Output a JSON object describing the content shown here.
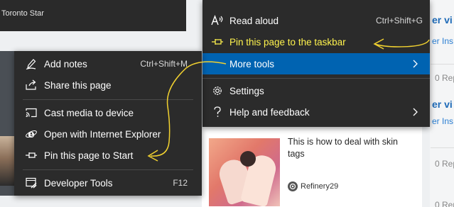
{
  "background": {
    "top_card_source": "Toronto Star",
    "right_column": {
      "link1": "er vi",
      "sub1": "er Ins",
      "replies1": "0 Repl",
      "link2": "er vi",
      "sub2": "er Ins",
      "replies2": "0 Repl",
      "replies3": "0 Repl"
    },
    "article": {
      "title": "This is how to deal with skin tags",
      "source": "Refinery29"
    }
  },
  "main_menu": {
    "items": [
      {
        "label": "Read aloud",
        "shortcut": "Ctrl+Shift+G",
        "icon": "read-aloud-icon"
      },
      {
        "label": "Pin this page to the taskbar",
        "icon": "pin-icon"
      },
      {
        "label": "More tools",
        "icon": "none"
      },
      {
        "label": "Settings",
        "icon": "gear-icon"
      },
      {
        "label": "Help and feedback",
        "icon": "question-mark-icon"
      }
    ]
  },
  "sub_menu": {
    "items": [
      {
        "label": "Add notes",
        "shortcut": "Ctrl+Shift+M",
        "icon": "pen-icon"
      },
      {
        "label": "Share this page",
        "icon": "share-icon"
      },
      {
        "label": "Cast media to device",
        "icon": "cast-icon"
      },
      {
        "label": "Open with Internet Explorer",
        "icon": "internet-explorer-icon"
      },
      {
        "label": "Pin this page to Start",
        "icon": "pin-icon"
      },
      {
        "label": "Developer Tools",
        "shortcut": "F12",
        "icon": "developer-tools-icon"
      }
    ]
  },
  "colors": {
    "menu_bg": "#2b2b2b",
    "highlight": "#0063b1",
    "annotation_yellow": "#f2d230",
    "link_blue": "#1f6bb8"
  }
}
